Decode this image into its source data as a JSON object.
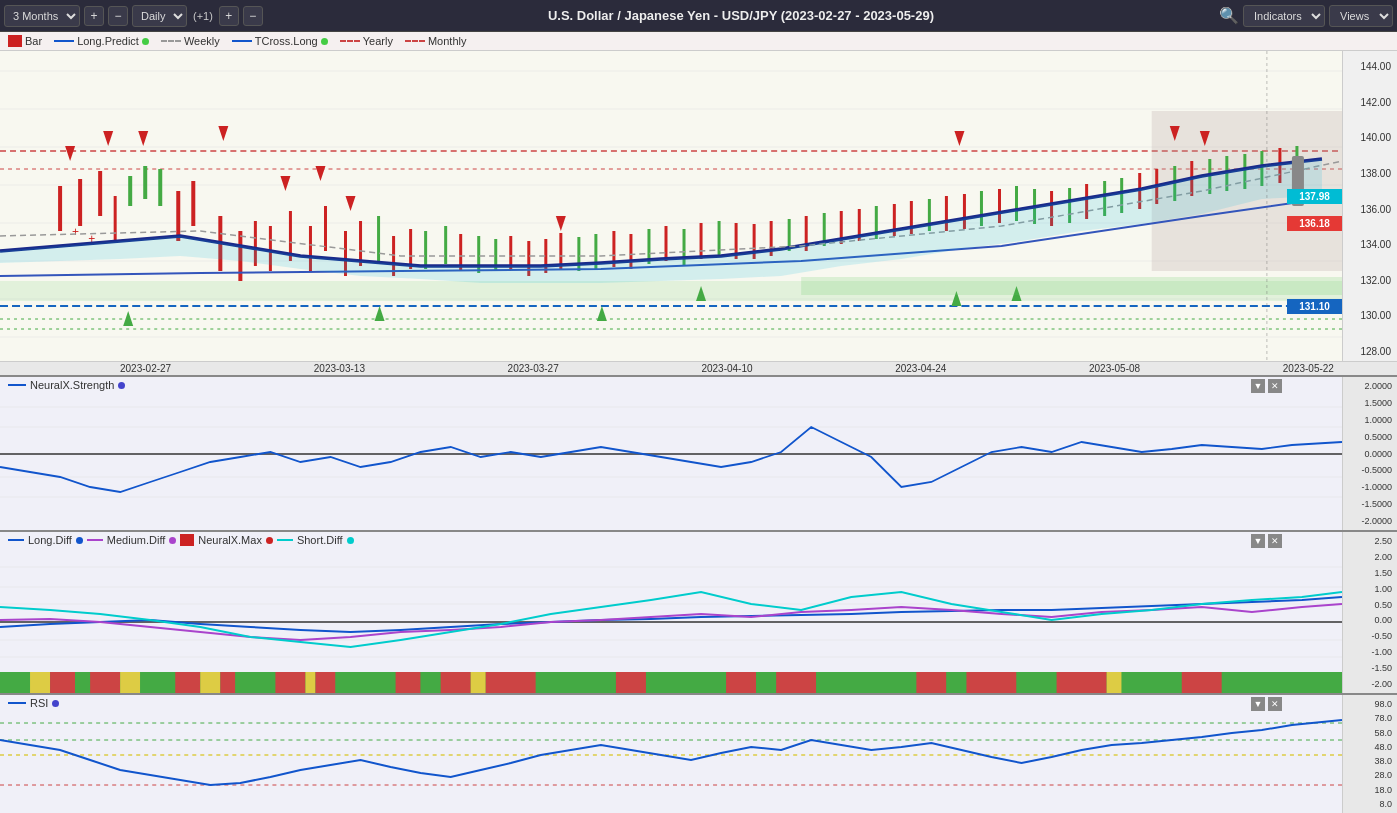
{
  "toolbar": {
    "period_label": "3 Months",
    "increment_label": "(+1)",
    "timeframe_label": "Daily",
    "title": "U.S. Dollar / Japanese Yen - USD/JPY (2023-02-27 - 2023-05-29)",
    "indicators_label": "Indicators",
    "views_label": "Views"
  },
  "legend": {
    "items": [
      {
        "label": "Bar",
        "color": "#cc2222",
        "type": "square"
      },
      {
        "label": "Long.Predict",
        "color": "#1155cc",
        "type": "line"
      },
      {
        "label": "Weekly",
        "color": "#999999",
        "type": "dashed"
      },
      {
        "label": "TCross.Long",
        "color": "#1155cc",
        "type": "solid"
      },
      {
        "label": "Yearly",
        "color": "#cc4444",
        "type": "dashed"
      },
      {
        "label": "Monthly",
        "color": "#cc4444",
        "type": "dashed"
      }
    ]
  },
  "price_chart": {
    "prices": [
      144,
      142,
      140,
      138,
      136,
      134,
      132,
      130,
      128
    ],
    "badge_137": {
      "value": "137.98",
      "color": "#00bcd4"
    },
    "badge_136": {
      "value": "136.18",
      "color": "#e53935"
    },
    "badge_131": {
      "value": "131.10",
      "color": "#1565c0"
    }
  },
  "date_axis": {
    "labels": [
      "2023-02-27",
      "2023-03-13",
      "2023-03-27",
      "2023-04-10",
      "2023-04-24",
      "2023-05-08",
      "2023-05-22"
    ]
  },
  "neuralx_panel": {
    "title": "NeuralX.Strength",
    "dot_color": "#4444cc",
    "values": [
      "2.0000",
      "1.5000",
      "1.0000",
      "0.5000",
      "0.0000",
      "-0.5000",
      "-1.0000",
      "-1.5000",
      "-2.0000"
    ]
  },
  "diff_panel": {
    "title_items": [
      {
        "label": "Long.Diff",
        "color": "#1155cc",
        "dot": "#1155cc"
      },
      {
        "label": "Medium.Diff",
        "color": "#aa44cc",
        "dot": "#aa44cc"
      },
      {
        "label": "NeuralX.Max",
        "color": "#cc2222",
        "dot": "#cc2222"
      },
      {
        "label": "Short.Diff",
        "color": "#00cccc",
        "dot": "#00cccc"
      }
    ],
    "values": [
      "2.50",
      "2.00",
      "1.50",
      "1.00",
      "0.50",
      "0.00",
      "-0.50",
      "-1.00",
      "-1.50",
      "-2.00"
    ]
  },
  "rsi_panel": {
    "title": "RSI",
    "dot_color": "#4444cc",
    "values": [
      "98.0",
      "78.0",
      "58.0",
      "48.0",
      "38.0",
      "28.0",
      "18.0",
      "8.0"
    ]
  }
}
